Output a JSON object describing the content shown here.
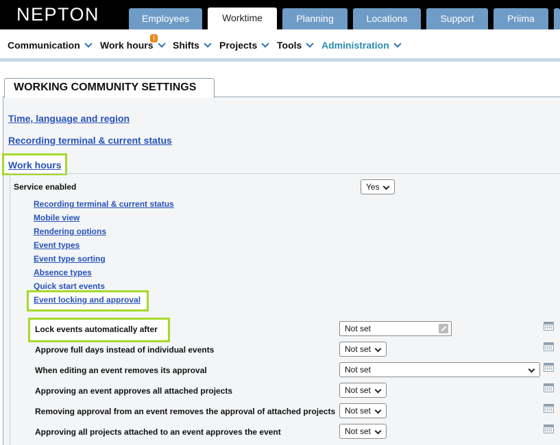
{
  "app": {
    "logo": "NEPTON"
  },
  "tabs": [
    {
      "label": "Employees",
      "active": false
    },
    {
      "label": "Worktime",
      "active": true
    },
    {
      "label": "Planning",
      "active": false
    },
    {
      "label": "Locations",
      "active": false
    },
    {
      "label": "Support",
      "active": false
    },
    {
      "label": "Priima",
      "active": false
    }
  ],
  "nav": {
    "items": [
      {
        "label": "Communication"
      },
      {
        "label": "Work hours",
        "badge": "!"
      },
      {
        "label": "Shifts"
      },
      {
        "label": "Projects"
      },
      {
        "label": "Tools"
      },
      {
        "label": "Administration",
        "active": true
      }
    ]
  },
  "panel": {
    "title": "WORKING COMMUNITY SETTINGS",
    "sections": [
      {
        "label": "Time, language and region"
      },
      {
        "label": "Recording terminal & current status"
      },
      {
        "label": "Work hours"
      }
    ]
  },
  "workhours": {
    "service_label": "Service enabled",
    "service_value": "Yes",
    "links": [
      "Recording terminal & current status",
      "Mobile view",
      "Rendering options",
      "Event types",
      "Event type sorting",
      "Absence types",
      "Quick start events",
      "Event locking and approval"
    ],
    "settings": [
      {
        "label": "Lock events automatically after",
        "value": "Not set"
      },
      {
        "label": "Approve full days instead of individual events",
        "value": "Not set"
      },
      {
        "label": "When editing an event removes its approval",
        "value": "Not set"
      },
      {
        "label": "Approving an event approves all attached projects",
        "value": "Not set"
      },
      {
        "label": "Removing approval from an event removes the approval of attached projects",
        "value": "Not set"
      },
      {
        "label": "Approving all projects attached to an event approves the event",
        "value": "Not set"
      }
    ]
  },
  "colors": {
    "highlight": "#a6d92b",
    "link": "#2752b8",
    "tab": "#6f9cc7",
    "admin": "#2b8bb1"
  }
}
